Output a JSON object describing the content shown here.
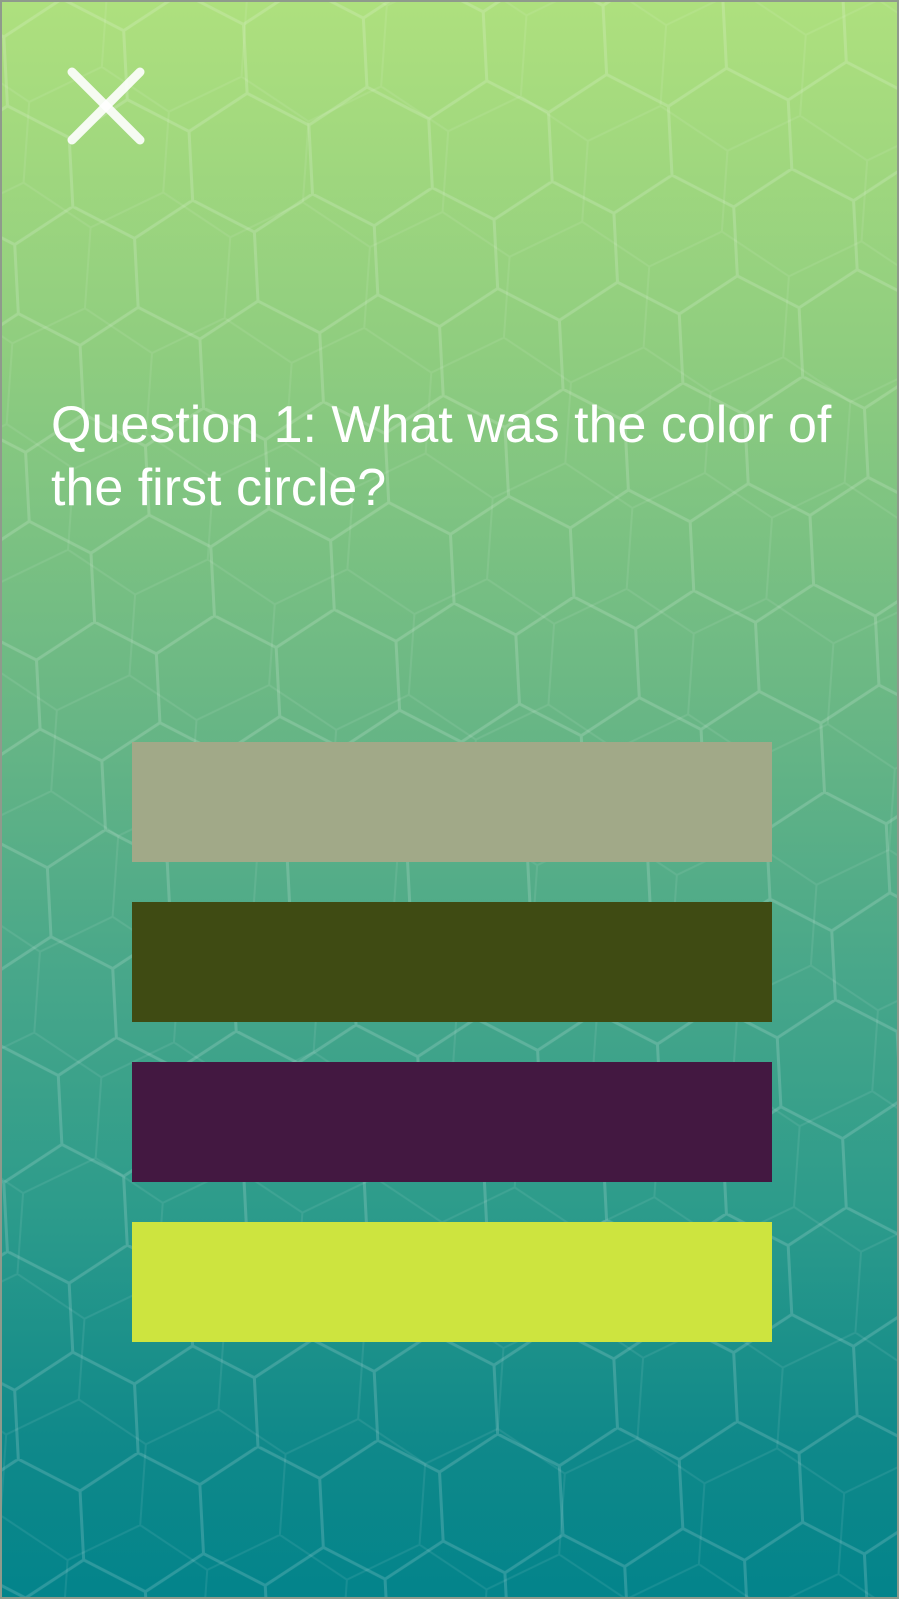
{
  "question": {
    "text": "Question 1: What was the color of the first circle?"
  },
  "close_button": {
    "icon": "close-icon"
  },
  "answers": [
    {
      "color": "#a1a988"
    },
    {
      "color": "#3f4b13"
    },
    {
      "color": "#431841"
    },
    {
      "color": "#cde43f"
    }
  ],
  "theme": {
    "text_color": "#ffffff",
    "gradient_top": "#aee07e",
    "gradient_bottom": "#03848b"
  }
}
